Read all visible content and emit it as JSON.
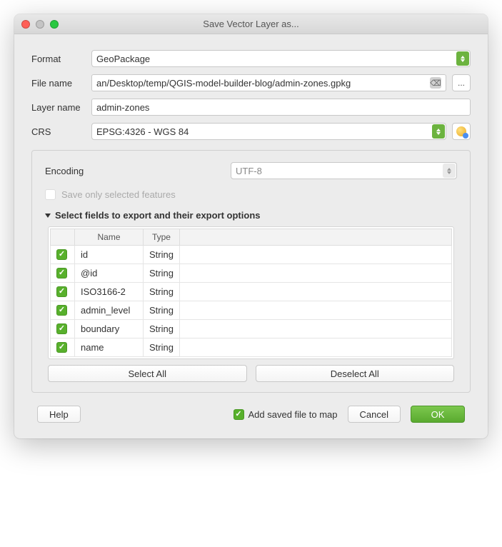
{
  "window": {
    "title": "Save Vector Layer as..."
  },
  "labels": {
    "format": "Format",
    "file_name": "File name",
    "layer_name": "Layer name",
    "crs": "CRS",
    "encoding": "Encoding",
    "save_selected": "Save only selected features",
    "section_fields": "Select fields to export and their export options"
  },
  "values": {
    "format": "GeoPackage",
    "file_name": "an/Desktop/temp/QGIS-model-builder-blog/admin-zones.gpkg",
    "layer_name": "admin-zones",
    "crs": "EPSG:4326 - WGS 84",
    "encoding": "UTF-8"
  },
  "table": {
    "headers": {
      "name": "Name",
      "type": "Type"
    },
    "rows": [
      {
        "checked": true,
        "name": "id",
        "type": "String"
      },
      {
        "checked": true,
        "name": "@id",
        "type": "String"
      },
      {
        "checked": true,
        "name": "ISO3166-2",
        "type": "String"
      },
      {
        "checked": true,
        "name": "admin_level",
        "type": "String"
      },
      {
        "checked": true,
        "name": "boundary",
        "type": "String"
      },
      {
        "checked": true,
        "name": "name",
        "type": "String"
      }
    ]
  },
  "buttons": {
    "select_all": "Select All",
    "deselect_all": "Deselect All",
    "help": "Help",
    "cancel": "Cancel",
    "ok": "OK",
    "browse": "...",
    "add_to_map": "Add saved file to map"
  },
  "state": {
    "add_to_map_checked": true,
    "save_selected_enabled": false
  }
}
